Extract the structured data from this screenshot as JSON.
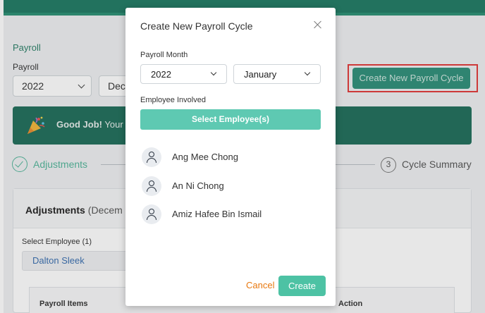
{
  "page": {
    "breadcrumb": "Payroll",
    "payroll_label": "Payroll",
    "year_value": "2022",
    "month_value": "Dece",
    "create_cycle_button": "Create New Payroll Cycle",
    "banner_bold": "Good Job!",
    "banner_text": " Your pa",
    "step1_label": "Adjustments",
    "step3_number": "3",
    "step3_label": "Cycle Summary",
    "card_title": "Adjustments",
    "card_subtitle": "(Decem",
    "select_employee_label": "Select Employee (1)",
    "selected_employee": "Dalton Sleek",
    "table_headers": [
      "Payroll Items",
      "Action"
    ]
  },
  "modal": {
    "title": "Create New Payroll Cycle",
    "payroll_month_label": "Payroll Month",
    "year_value": "2022",
    "month_value": "January",
    "employee_involved_label": "Employee Involved",
    "select_employees_button": "Select Employee(s)",
    "employees": [
      "Ang Mee Chong",
      "An Ni Chong",
      "Amiz Hafee Bin Ismail"
    ],
    "cancel_label": "Cancel",
    "create_label": "Create"
  },
  "colors": {
    "brand_green": "#1f7a63",
    "accent_teal": "#4dc2a4",
    "cancel_orange": "#e8780f",
    "highlight_red": "#e23a3a"
  }
}
